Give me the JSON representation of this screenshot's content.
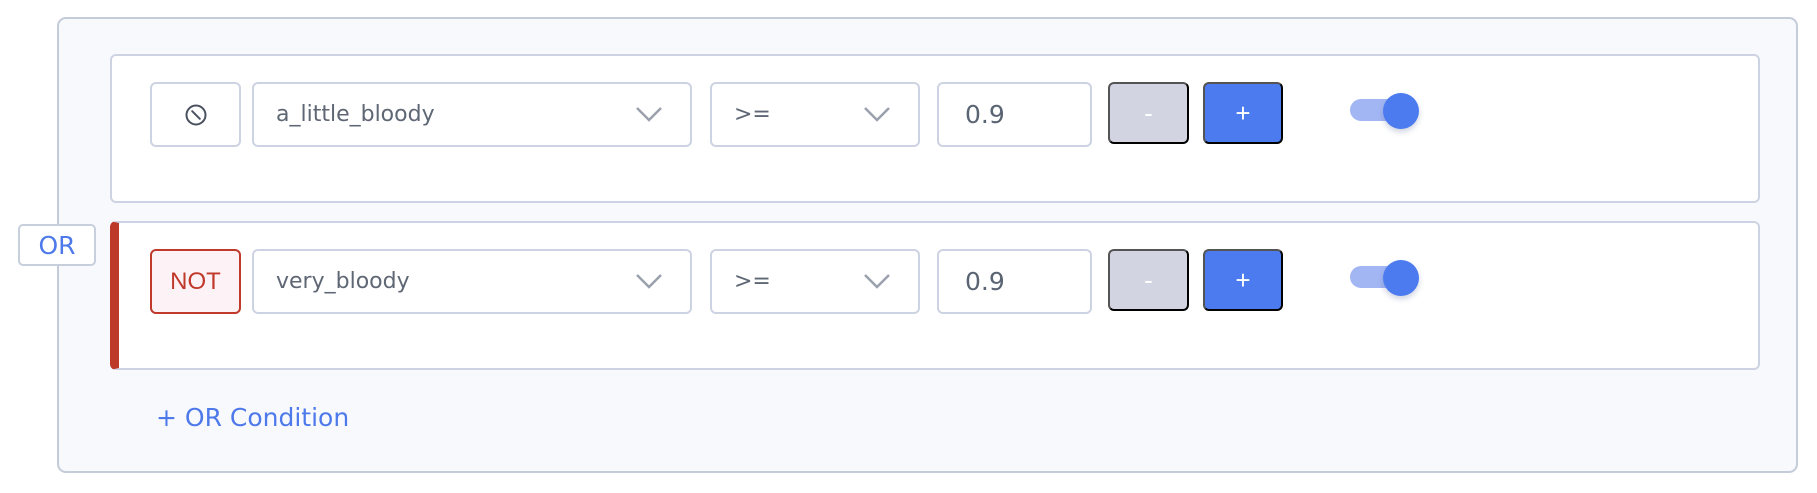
{
  "group": {
    "operator_label": "OR",
    "add_condition_label": "+ OR Condition",
    "conditions": [
      {
        "negate_icon": "no-symbol-icon",
        "negated": false,
        "field": "a_little_bloody",
        "operator": ">=",
        "value": "0.9",
        "minus_label": "-",
        "plus_label": "+",
        "enabled": true
      },
      {
        "negate_label": "NOT",
        "negated": true,
        "field": "very_bloody",
        "operator": ">=",
        "value": "0.9",
        "minus_label": "-",
        "plus_label": "+",
        "enabled": true
      }
    ]
  },
  "colors": {
    "accent": "#4b7bef",
    "negate": "#bd3a28",
    "disabled_button": "#d2d5e1"
  }
}
